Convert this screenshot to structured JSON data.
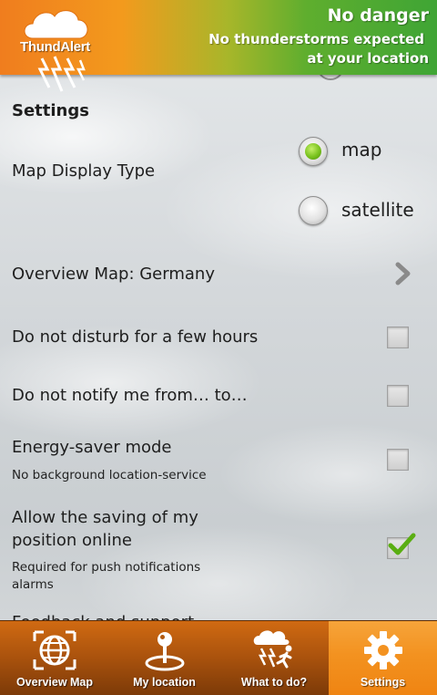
{
  "header": {
    "logo_text": "ThundAlert",
    "status_title": "No danger",
    "status_line1": "No thunderstorms expected",
    "status_line2": "at your location",
    "gradient_colors": [
      "#f07d1e",
      "#3fa535"
    ]
  },
  "settings": {
    "section_title": "Settings",
    "map_display": {
      "label": "Map Display Type",
      "options": [
        {
          "label": "map",
          "checked": true
        },
        {
          "label": "satellite",
          "checked": false
        }
      ]
    },
    "overview_map": {
      "label": "Overview Map: Germany",
      "icon": "chevron-right-icon"
    },
    "do_not_disturb": {
      "label": "Do not disturb for a few hours",
      "checked": false
    },
    "do_not_notify": {
      "label": "Do not notify me from… to…",
      "checked": false
    },
    "energy_saver": {
      "label": "Energy-saver mode",
      "sub": "No background location-service",
      "checked": false
    },
    "allow_saving": {
      "label_line1": "Allow the saving of my",
      "label_line2": "position online",
      "sub_line1": "Required for push notifications",
      "sub_line2": "alarms",
      "checked": true
    },
    "next_item_cut": "Feedback and support"
  },
  "bottom_nav": {
    "items": [
      {
        "label": "Overview Map",
        "icon": "globe-map-icon",
        "active": false
      },
      {
        "label": "My location",
        "icon": "location-pin-icon",
        "active": false
      },
      {
        "label": "What to do?",
        "icon": "storm-runner-icon",
        "active": false
      },
      {
        "label": "Settings",
        "icon": "gear-icon",
        "active": true
      }
    ]
  },
  "colors": {
    "accent_green": "#79c21e",
    "nav_active": "#f39220",
    "nav_bg": "#a9520d"
  }
}
